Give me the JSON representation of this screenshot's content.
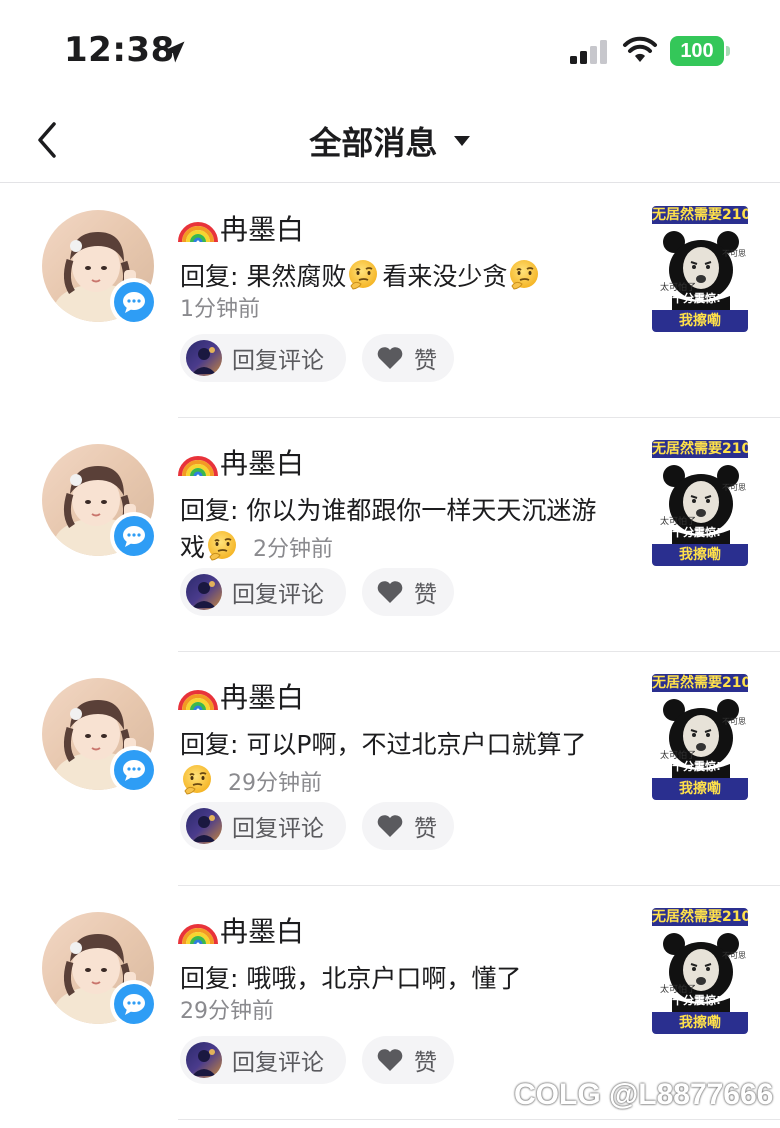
{
  "status_bar": {
    "time": "12:38",
    "battery": "100",
    "battery_color": "#34c759"
  },
  "nav": {
    "title": "全部消息",
    "back_icon": "chevron-left-icon",
    "caret_icon": "triangle-down-icon"
  },
  "messages": [
    {
      "username": "冉墨白",
      "text": "回复: 果然腐败🤔看来没少贪🤔",
      "segments": [
        "回复: 果然腐败",
        "看来没少贪"
      ],
      "time": "1分钟前",
      "thumb": {
        "banner": "无居然需要210",
        "caption": "十分震惊!",
        "footer": "我擦嘞",
        "side": "太可怕了",
        "side2": "不可思"
      },
      "reply_label": "回复评论",
      "like_label": "赞"
    },
    {
      "username": "冉墨白",
      "text": "回复: 你以为谁都跟你一样天天沉迷游戏🤔",
      "segments": [
        "回复: 你以为谁都跟你一样天天沉迷游戏"
      ],
      "time": "2分钟前",
      "thumb": {
        "banner": "无居然需要210",
        "caption": "十分震惊!",
        "footer": "我擦嘞",
        "side": "太可怕了",
        "side2": "不可思"
      },
      "reply_label": "回复评论",
      "like_label": "赞"
    },
    {
      "username": "冉墨白",
      "text": "回复: 可以P啊，不过北京户口就算了🤔",
      "segments": [
        "回复: 可以P啊，不过北京户口就算了"
      ],
      "time": "29分钟前",
      "thumb": {
        "banner": "无居然需要210",
        "caption": "十分震惊!",
        "footer": "我擦嘞",
        "side": "太可怕了",
        "side2": "不可思"
      },
      "reply_label": "回复评论",
      "like_label": "赞"
    },
    {
      "username": "冉墨白",
      "text": "回复: 哦哦，北京户口啊，懂了",
      "segments": [
        "回复: 哦哦，北京户口啊，懂了"
      ],
      "time": "29分钟前",
      "thumb": {
        "banner": "无居然需要210",
        "caption": "十分震惊!",
        "footer": "我擦嘞",
        "side": "太可怕了",
        "side2": "不可思"
      },
      "reply_label": "回复评论",
      "like_label": "赞"
    }
  ],
  "watermark": "COLG @L8877666",
  "icons": {
    "rainbow": "rainbow-icon",
    "emoji": "thinking-face-icon",
    "badge": "chat-bubble-icon",
    "heart": "heart-icon"
  },
  "colors": {
    "accent_blue": "#2e9df5",
    "secondary_text": "#8a8a8e",
    "pill_bg": "#f4f4f6"
  }
}
